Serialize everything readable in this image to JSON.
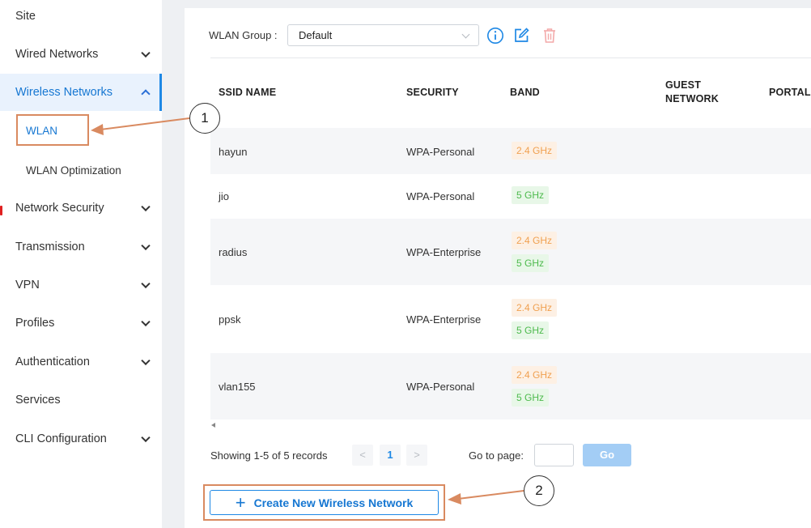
{
  "sidebar": {
    "items": [
      {
        "label": "Site"
      },
      {
        "label": "Wired Networks"
      },
      {
        "label": "Wireless Networks"
      },
      {
        "label": "WLAN"
      },
      {
        "label": "WLAN Optimization"
      },
      {
        "label": "Network Security"
      },
      {
        "label": "Transmission"
      },
      {
        "label": "VPN"
      },
      {
        "label": "Profiles"
      },
      {
        "label": "Authentication"
      },
      {
        "label": "Services"
      },
      {
        "label": "CLI Configuration"
      }
    ]
  },
  "wlan_group": {
    "label": "WLAN Group :",
    "value": "Default",
    "icons": [
      "info-icon",
      "edit-icon",
      "delete-icon"
    ]
  },
  "table": {
    "columns": [
      "SSID NAME",
      "SECURITY",
      "BAND",
      "GUEST\nNETWORK",
      "PORTAL"
    ],
    "rows": [
      {
        "ssid": "hayun",
        "security": "WPA-Personal",
        "bands": [
          "2.4 GHz"
        ]
      },
      {
        "ssid": "jio",
        "security": "WPA-Personal",
        "bands": [
          "5 GHz"
        ]
      },
      {
        "ssid": "radius",
        "security": "WPA-Enterprise",
        "bands": [
          "2.4 GHz",
          "5 GHz"
        ]
      },
      {
        "ssid": "ppsk",
        "security": "WPA-Enterprise",
        "bands": [
          "2.4 GHz",
          "5 GHz"
        ]
      },
      {
        "ssid": "vlan155",
        "security": "WPA-Personal",
        "bands": [
          "2.4 GHz",
          "5 GHz"
        ]
      }
    ]
  },
  "pagination": {
    "summary": "Showing 1-5 of 5 records",
    "prev": "<",
    "current_page": "1",
    "next": ">",
    "goto_label": "Go to page:",
    "go_label": "Go"
  },
  "create_button": {
    "plus": "+",
    "label": "Create New Wireless Network"
  },
  "callouts": [
    "1",
    "2"
  ],
  "colors": {
    "accent": "#1e88e5",
    "band_24_text": "#f0a050",
    "band_5_text": "#4cba4c",
    "annotation": "#d98a60"
  }
}
